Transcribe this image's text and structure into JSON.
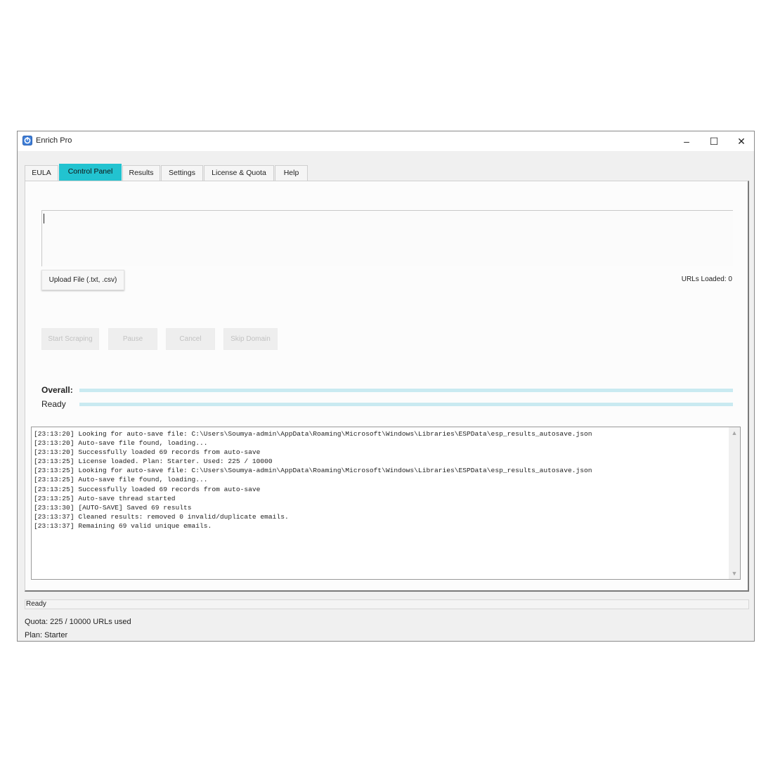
{
  "window": {
    "title": "Enrich Pro",
    "minimize_glyph": "–",
    "maximize_glyph": "☐",
    "close_glyph": "✕",
    "app_icon": "enrich-pro-logo-icon"
  },
  "tabs": [
    {
      "label": "EULA",
      "active": false
    },
    {
      "label": "Control Panel",
      "active": true
    },
    {
      "label": "Results",
      "active": false
    },
    {
      "label": "Settings",
      "active": false
    },
    {
      "label": "License & Quota",
      "active": false
    },
    {
      "label": "Help",
      "active": false
    }
  ],
  "control_panel": {
    "url_input_value": "",
    "upload_button": "Upload File (.txt, .csv)",
    "urls_loaded": "URLs Loaded: 0",
    "buttons": {
      "start": "Start Scraping",
      "pause": "Pause",
      "cancel": "Cancel",
      "skip": "Skip Domain"
    },
    "overall_label": "Overall:",
    "overall_progress": 1.0,
    "status_label": "Ready",
    "status_progress": 1.0
  },
  "log": {
    "lines": [
      "[23:13:20] Looking for auto-save file: C:\\Users\\Soumya-admin\\AppData\\Roaming\\Microsoft\\Windows\\Libraries\\ESPData\\esp_results_autosave.json",
      "[23:13:20] Auto-save file found, loading...",
      "[23:13:20] Successfully loaded 69 records from auto-save",
      "[23:13:25] License loaded. Plan: Starter. Used: 225 / 10000",
      "[23:13:25] Looking for auto-save file: C:\\Users\\Soumya-admin\\AppData\\Roaming\\Microsoft\\Windows\\Libraries\\ESPData\\esp_results_autosave.json",
      "[23:13:25] Auto-save file found, loading...",
      "[23:13:25] Successfully loaded 69 records from auto-save",
      "[23:13:25] Auto-save thread started",
      "[23:13:30] [AUTO-SAVE] Saved 69 results",
      "[23:13:37] Cleaned results: removed 0 invalid/duplicate emails.",
      "[23:13:37] Remaining 69 valid unique emails."
    ],
    "scroll_up_glyph": "▲",
    "scroll_down_glyph": "▼"
  },
  "status_bar": "Ready",
  "footer": {
    "quota": "Quota: 225 / 10000 URLs used",
    "plan": "Plan: Starter"
  }
}
